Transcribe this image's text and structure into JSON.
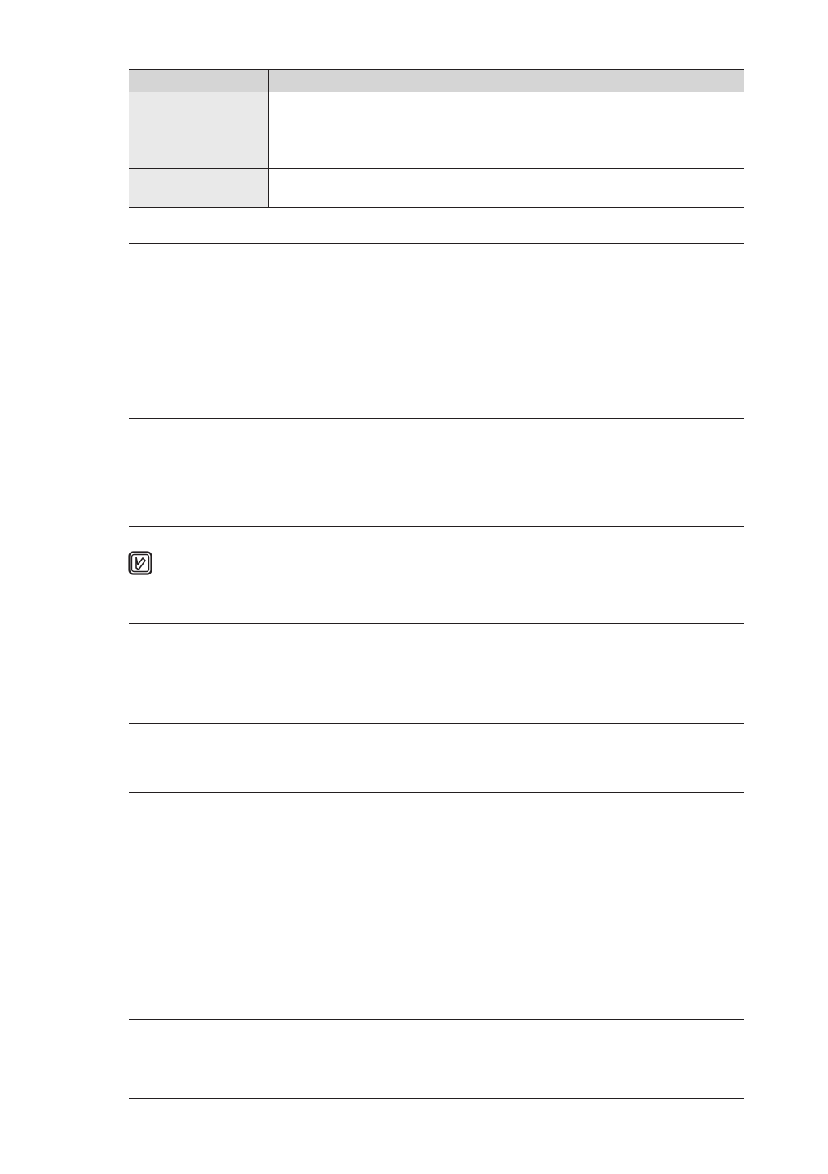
{
  "document": {
    "table": {
      "columns": [
        "",
        ""
      ],
      "rows": [
        [
          "",
          ""
        ],
        [
          "",
          ""
        ],
        [
          "",
          ""
        ]
      ]
    },
    "note": {
      "icon": "note-pencil-icon",
      "text": ""
    },
    "colors": {
      "rule": "#231f20",
      "header_fill": "#d5d5d5",
      "label_fill": "#e9e9e9"
    }
  }
}
